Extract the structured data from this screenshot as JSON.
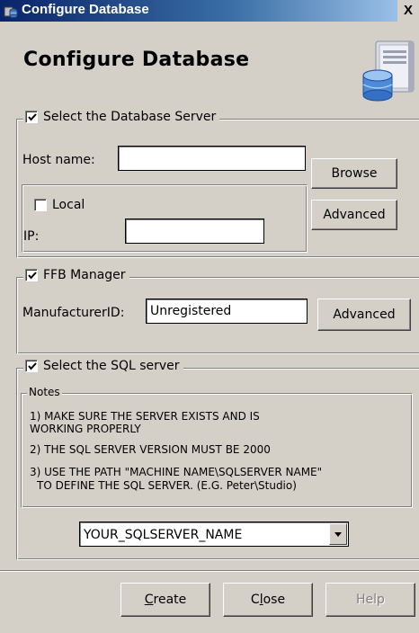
{
  "window": {
    "title": "Configure Database",
    "close_glyph": "X"
  },
  "heading": "Configure Database",
  "db_server": {
    "legend": "Select the Database Server",
    "checked": true,
    "host_label": "Host name:",
    "host_value": "",
    "browse_label": "Browse",
    "local_label": "Local",
    "local_checked": false,
    "ip_label": "IP:",
    "ip_value": "",
    "advanced_label": "Advanced"
  },
  "ffb_manager": {
    "legend": "FFB Manager",
    "checked": true,
    "manufacturer_label": "ManufacturerID:",
    "manufacturer_value": "Unregistered",
    "advanced_label": "Advanced"
  },
  "sql_server": {
    "legend": "Select the SQL server",
    "checked": true,
    "notes_legend": "Notes",
    "notes": [
      "1) MAKE SURE THE SERVER EXISTS AND IS",
      "WORKING PROPERLY",
      "2) THE SQL SERVER VERSION MUST BE 2000",
      "3) USE THE PATH \"MACHINE NAME\\SQLSERVER NAME\"",
      "TO DEFINE THE SQL SERVER.  (E.G. Peter\\Studio)"
    ],
    "selected_server": "YOUR_SQLSERVER_NAME"
  },
  "footer": {
    "create_label": "Create",
    "create_mnemonic": "C",
    "create_rest": "reate",
    "close_label": "Close",
    "close_pre": "C",
    "close_mnemonic": "l",
    "close_rest": "ose",
    "help_label": "Help"
  }
}
